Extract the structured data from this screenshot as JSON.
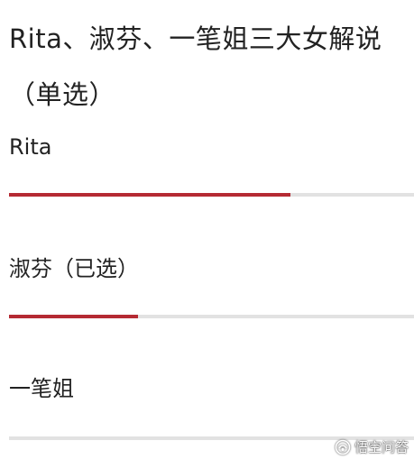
{
  "poll": {
    "question": "Rita、淑芬、一笔姐三大女解说（单选）",
    "options": [
      {
        "label": "Rita",
        "progress": 0.695,
        "selected": false
      },
      {
        "label": "淑芬（已选）",
        "progress": 0.318,
        "selected": true
      },
      {
        "label": "一笔姐",
        "progress": 0.0,
        "selected": false
      }
    ],
    "bar_color": "#b52a33",
    "track_color": "#e2e2e2"
  },
  "watermark": {
    "text": "悟空问答",
    "icon": "wukong-logo-icon"
  }
}
